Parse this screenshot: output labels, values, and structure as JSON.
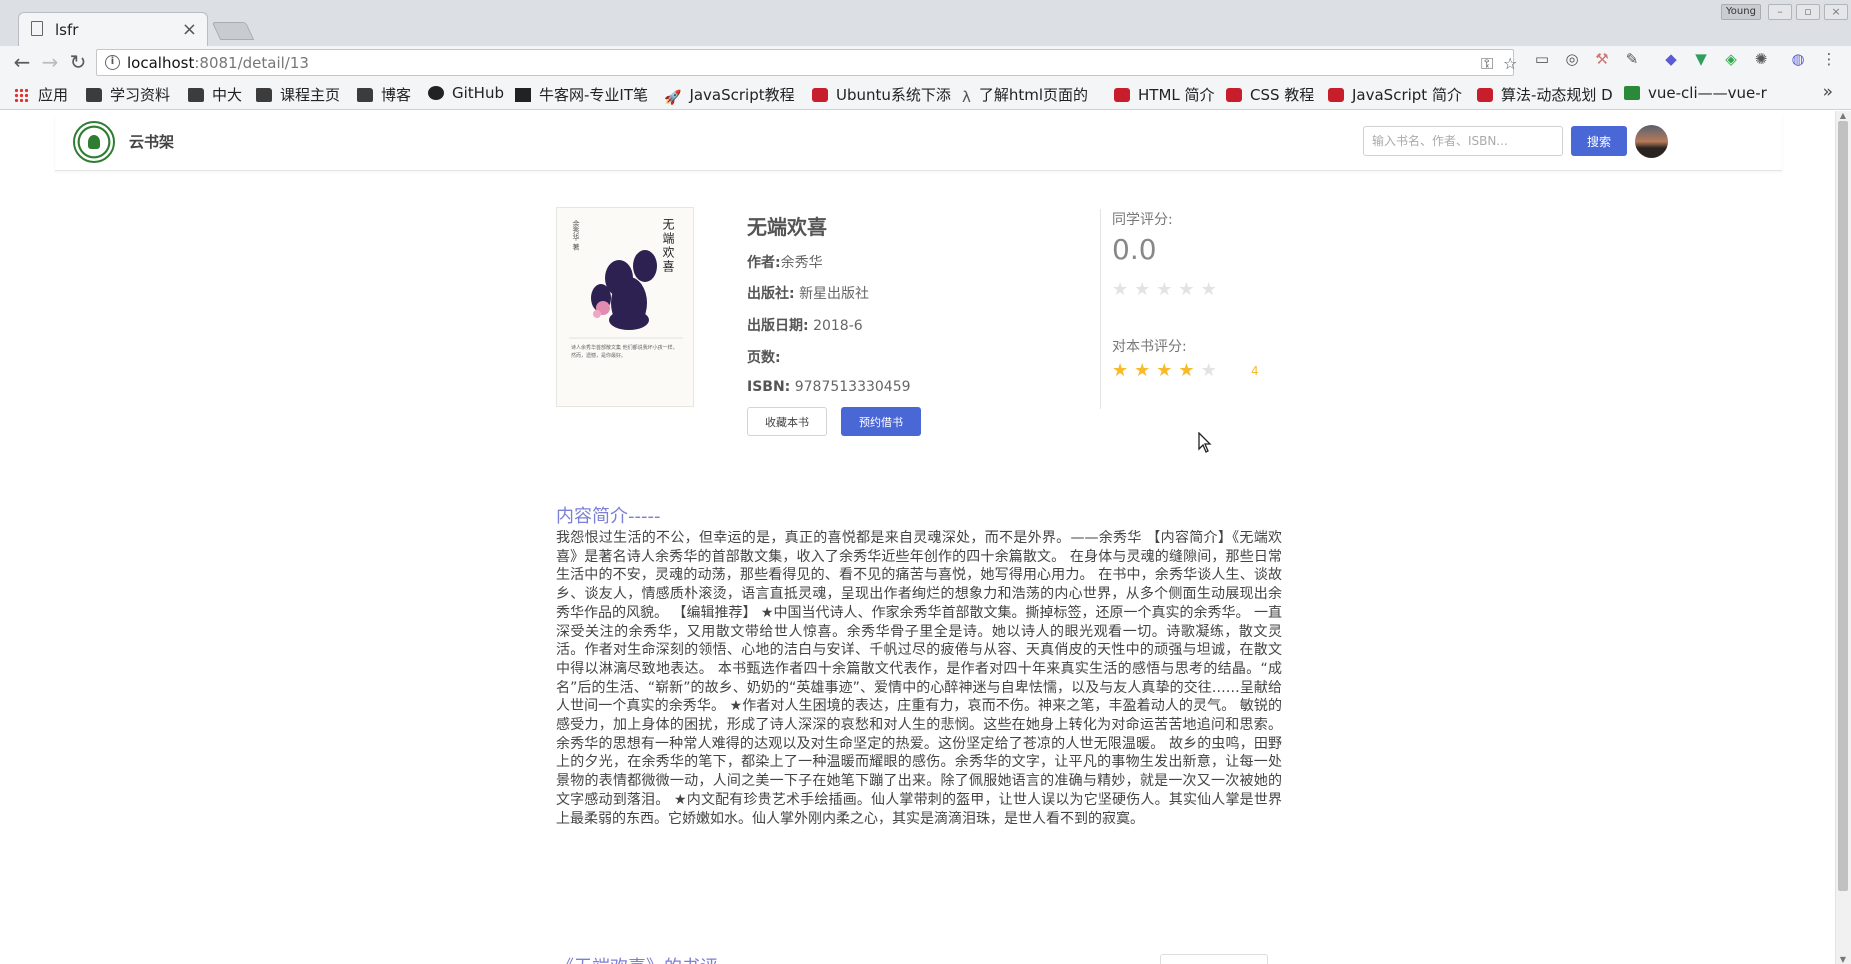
{
  "browser": {
    "tab_title": "lsfr",
    "tab_close": "×",
    "profile_label": "Young",
    "url_host": "localhost",
    "url_path": ":8081/detail/13",
    "back_icon": "←",
    "forward_icon": "→",
    "reload_icon": "↻",
    "key_icon": "key-icon",
    "bookmark_star_icon": "☆",
    "bookmarks": [
      {
        "label": "应用",
        "icon": "apps-icon"
      },
      {
        "label": "学习资料",
        "icon": "folder-icon"
      },
      {
        "label": "中大",
        "icon": "folder-icon"
      },
      {
        "label": "课程主页",
        "icon": "folder-icon"
      },
      {
        "label": "博客",
        "icon": "folder-icon"
      },
      {
        "label": "GitHub",
        "icon": "github-icon"
      },
      {
        "label": "牛客网-专业IT笔",
        "icon": "nowcoder-icon"
      },
      {
        "label": "JavaScript教程",
        "icon": "rocket-icon"
      },
      {
        "label": "Ubuntu系统下添",
        "icon": "csdn-icon"
      },
      {
        "label": "了解html页面的",
        "icon": "lambda-icon"
      },
      {
        "label": "HTML 简介",
        "icon": "runoob-icon"
      },
      {
        "label": "CSS 教程",
        "icon": "runoob-icon"
      },
      {
        "label": "JavaScript 简介",
        "icon": "runoob-icon"
      },
      {
        "label": "算法-动态规划 D",
        "icon": "csdn-icon"
      },
      {
        "label": "vue-cli——vue-r",
        "icon": "sf-icon"
      }
    ],
    "bookmarks_more": "»"
  },
  "site": {
    "name": "云书架",
    "search_placeholder": "输入书名、作者、ISBN...",
    "search_button": "搜索"
  },
  "book": {
    "title": "无端欢喜",
    "cover_title": "无端欢喜",
    "cover_author": "余秀华 著",
    "cover_subtitle": "诗人余秀华首部散文集 他们都说我坏小孩一样，然而，遗憾，是你最好。",
    "author_label": "作者:",
    "author": "余秀华",
    "publisher_label": "出版社:",
    "publisher": "新星出版社",
    "date_label": "出版日期:",
    "date": "2018-6",
    "pages_label": "页数:",
    "pages": "",
    "isbn_label": "ISBN:",
    "isbn": "9787513330459",
    "favorite_button": "收藏本书",
    "borrow_button": "预约借书"
  },
  "rating": {
    "classmates_label": "同学评分:",
    "classmates_score": "0.0",
    "classmates_stars": 0,
    "my_label": "对本书评分:",
    "my_stars": 4,
    "my_value": "4",
    "star_color": "#f7ba2a"
  },
  "intro": {
    "title": "内容简介-----",
    "body": "我怨恨过生活的不公，但幸运的是，真正的喜悦都是来自灵魂深处，而不是外界。——余秀华 【内容简介】《无端欢喜》是著名诗人余秀华的首部散文集，收入了余秀华近些年创作的四十余篇散文。 在身体与灵魂的缝隙间，那些日常生活中的不安，灵魂的动荡，那些看得见的、看不见的痛苦与喜悦，她写得用心用力。 在书中，余秀华谈人生、谈故乡、谈友人，情感质朴滚烫，语言直抵灵魂，呈现出作者绚烂的想象力和浩荡的内心世界，从多个侧面生动展现出余秀华作品的风貌。 【编辑推荐】 ★中国当代诗人、作家余秀华首部散文集。撕掉标签，还原一个真实的余秀华。 一直深受关注的余秀华，又用散文带给世人惊喜。余秀华骨子里全是诗。她以诗人的眼光观看一切。诗歌凝练，散文灵活。作者对生命深刻的领悟、心地的洁白与安详、千帆过尽的疲倦与从容、天真俏皮的天性中的顽强与坦诚，在散文中得以淋漓尽致地表达。 本书甄选作者四十余篇散文代表作，是作者对四十年来真实生活的感悟与思考的结晶。“成名”后的生活、“崭新”的故乡、奶奶的“英雄事迹”、爱情中的心醉神迷与自卑怯懦，以及与友人真挚的交往……呈献给人世间一个真实的余秀华。 ★作者对人生困境的表达，庄重有力，哀而不伤。神来之笔，丰盈着动人的灵气。 敏锐的感受力，加上身体的困扰，形成了诗人深深的哀愁和对人生的悲悯。这些在她身上转化为对命运苦苦地追问和思索。余秀华的思想有一种常人难得的达观以及对生命坚定的热爱。这份坚定给了苍凉的人世无限温暖。 故乡的虫鸣，田野上的夕光，在余秀华的笔下，都染上了一种温暖而耀眼的感伤。余秀华的文字，让平凡的事物生发出新意，让每一处景物的表情都微微一动，人间之美一下子在她笔下蹦了出来。除了佩服她语言的准确与精妙，就是一次又一次被她的文字感动到落泪。 ★内文配有珍贵艺术手绘插画。仙人掌带刺的盔甲，让世人误以为它坚硬伤人。其实仙人掌是世界上最柔弱的东西。它娇嫩如水。仙人掌外刚内柔之心，其实是滴滴泪珠，是世人看不到的寂寞。"
  },
  "reviews": {
    "title": "《无端欢喜》的书评"
  },
  "colors": {
    "accent": "#4a67d6",
    "heading": "#7b7fd6",
    "star": "#f7ba2a"
  }
}
